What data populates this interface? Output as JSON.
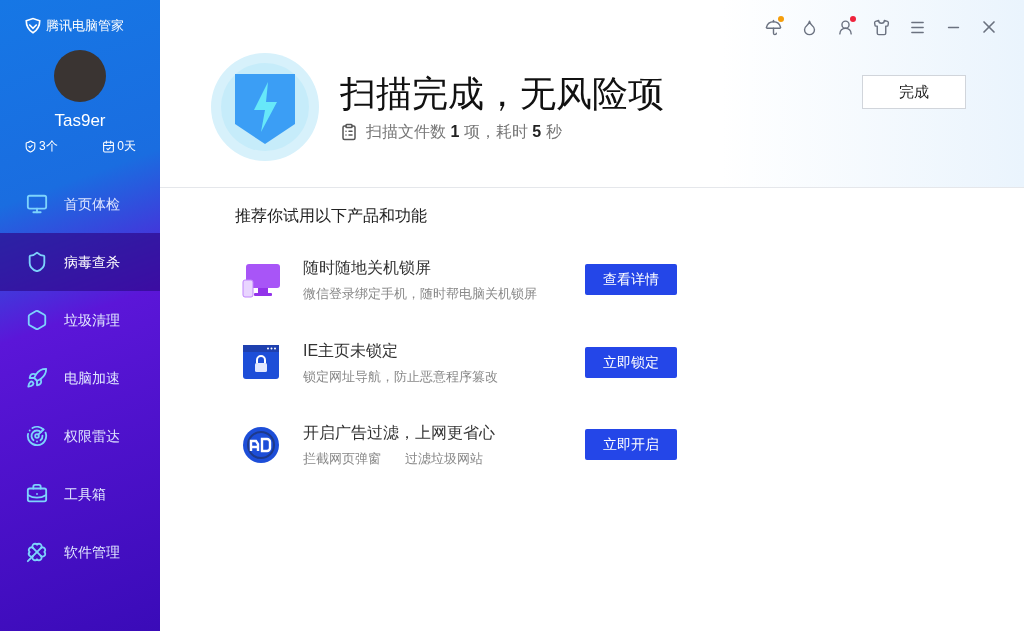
{
  "app": {
    "name": "腾讯电脑管家"
  },
  "user": {
    "name": "Tas9er",
    "stats": [
      "3个",
      "0天"
    ]
  },
  "sidebar": {
    "items": [
      {
        "label": "首页体检",
        "selected": false
      },
      {
        "label": "病毒查杀",
        "selected": true
      },
      {
        "label": "垃圾清理",
        "selected": false
      },
      {
        "label": "电脑加速",
        "selected": false
      },
      {
        "label": "权限雷达",
        "selected": false
      },
      {
        "label": "工具箱",
        "selected": false
      },
      {
        "label": "软件管理",
        "selected": false
      }
    ]
  },
  "toolbar": [
    {
      "kind": "umbrella",
      "color": "#f59e0b"
    },
    {
      "kind": "drop"
    },
    {
      "kind": "person",
      "color": "#ef233c"
    },
    {
      "kind": "shirt"
    },
    {
      "kind": "menu"
    },
    {
      "kind": "minimize"
    },
    {
      "kind": "close"
    }
  ],
  "result": {
    "title": "扫描完成，无风险项",
    "summary": "扫描文件数 **1** 项，耗时 **5** 秒",
    "button": "完成"
  },
  "recommend": {
    "heading": "推荐你试用以下产品和功能",
    "items": [
      {
        "kind": "monitor",
        "title": "随时随地关机锁屏",
        "details": [
          "微信登录绑定手机，随时帮电脑关机锁屏"
        ],
        "button": "查看详情"
      },
      {
        "kind": "lock",
        "title": "IE主页未锁定",
        "details": [
          "锁定网址导航，防止恶意程序篡改"
        ],
        "button": "立即锁定"
      },
      {
        "kind": "ad",
        "title": "开启广告过滤，上网更省心",
        "details": [
          "拦截网页弹窗",
          "过滤垃圾网站"
        ],
        "button": "立即开启"
      }
    ]
  }
}
